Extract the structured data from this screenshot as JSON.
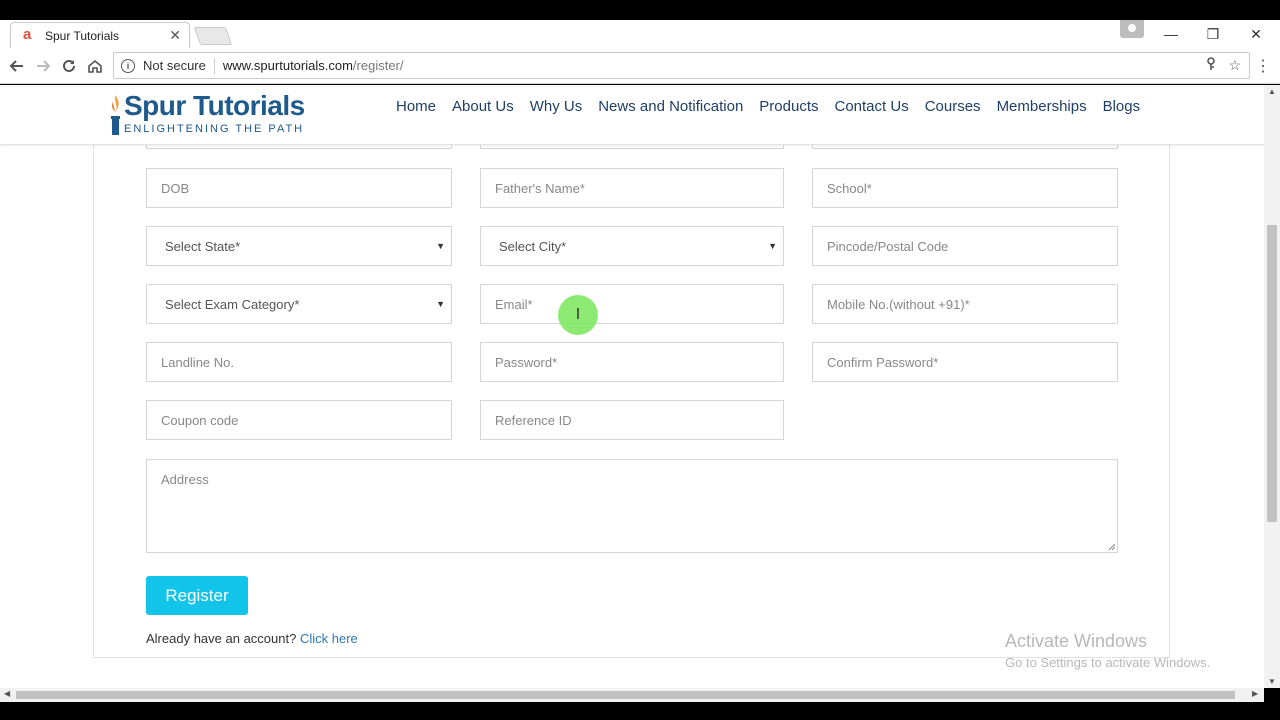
{
  "browser": {
    "tab_title": "Spur Tutorials",
    "tab_close": "✕",
    "favicon_letter": "a",
    "security_label": "Not secure",
    "url_host": "www.spurtutorials.com",
    "url_path": "/register/",
    "window_controls": {
      "minimize": "—",
      "restore": "❐",
      "close": "✕"
    }
  },
  "site": {
    "logo_name": "Spur Tutorials",
    "logo_tagline": "ENLIGHTENING THE PATH",
    "nav": [
      "Home",
      "About Us",
      "Why Us",
      "News and Notification",
      "Products",
      "Contact Us",
      "Courses",
      "Memberships",
      "Blogs"
    ]
  },
  "form": {
    "dob_placeholder": "DOB",
    "father_name_placeholder": "Father's Name*",
    "school_placeholder": "School*",
    "state_select": "Select State*",
    "city_select": "Select City*",
    "pincode_placeholder": "Pincode/Postal Code",
    "exam_category_select": "Select Exam Category*",
    "email_placeholder": "Email*",
    "mobile_placeholder": "Mobile No.(without +91)*",
    "landline_placeholder": "Landline No.",
    "password_placeholder": "Password*",
    "confirm_password_placeholder": "Confirm Password*",
    "coupon_placeholder": "Coupon code",
    "reference_placeholder": "Reference ID",
    "address_placeholder": "Address",
    "register_label": "Register",
    "login_prompt": "Already have an account?",
    "login_link": "Click here"
  },
  "overlay": {
    "activate_title": "Activate Windows",
    "activate_sub": "Go to Settings to activate Windows."
  },
  "colors": {
    "brand": "#1f5a8c",
    "button": "#12c4ea",
    "link": "#2f79b5"
  }
}
